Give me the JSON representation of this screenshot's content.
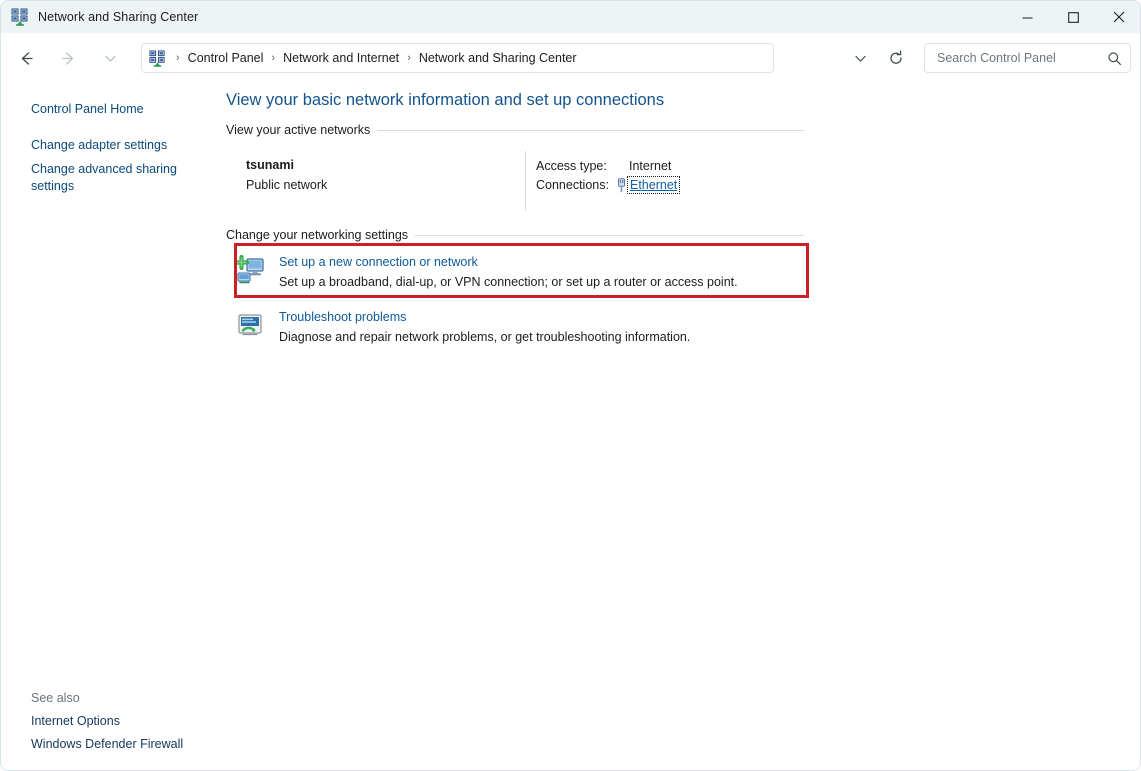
{
  "window": {
    "title": "Network and Sharing Center",
    "icon": "network-sharing-icon",
    "controls": {
      "minimize": "—",
      "maximize": "□",
      "close": "✕"
    }
  },
  "navbar": {
    "back_icon": "back-arrow-icon",
    "forward_icon": "forward-arrow-icon",
    "recent_icon": "chevron-down-icon",
    "up_icon": "up-arrow-icon",
    "dropdown_icon": "chevron-down-icon",
    "refresh_icon": "refresh-icon",
    "breadcrumb": {
      "icon": "network-sharing-icon",
      "separator": "›",
      "items": [
        "Control Panel",
        "Network and Internet",
        "Network and Sharing Center"
      ]
    }
  },
  "search": {
    "placeholder": "Search Control Panel",
    "value": "",
    "icon": "search-icon"
  },
  "sidebar": {
    "home_label": "Control Panel Home",
    "links": [
      "Change adapter settings",
      "Change advanced sharing settings"
    ],
    "see_also": {
      "title": "See also",
      "items": [
        "Internet Options",
        "Windows Defender Firewall"
      ]
    }
  },
  "main": {
    "page_title": "View your basic network information and set up connections",
    "sections": [
      {
        "heading": "View your active networks"
      },
      {
        "heading": "Change your networking settings"
      }
    ],
    "active_network": {
      "name": "tsunami",
      "type": "Public network",
      "access_type_label": "Access type:",
      "access_type_value": "Internet",
      "connections_label": "Connections:",
      "connection_icon": "ethernet-cable-icon",
      "connection_link": "Ethernet"
    },
    "tasks": [
      {
        "icon": "new-connection-icon",
        "link": "Set up a new connection or network",
        "description": "Set up a broadband, dial-up, or VPN connection; or set up a router or access point.",
        "highlighted": true
      },
      {
        "icon": "troubleshoot-icon",
        "link": "Troubleshoot problems",
        "description": "Diagnose and repair network problems, or get troubleshooting information.",
        "highlighted": false
      }
    ]
  },
  "colors": {
    "titlebar_bg": "#eef4f6",
    "link_blue": "#0d5a99",
    "heading_blue": "#14538b",
    "annotation_red": "#cc2027"
  }
}
